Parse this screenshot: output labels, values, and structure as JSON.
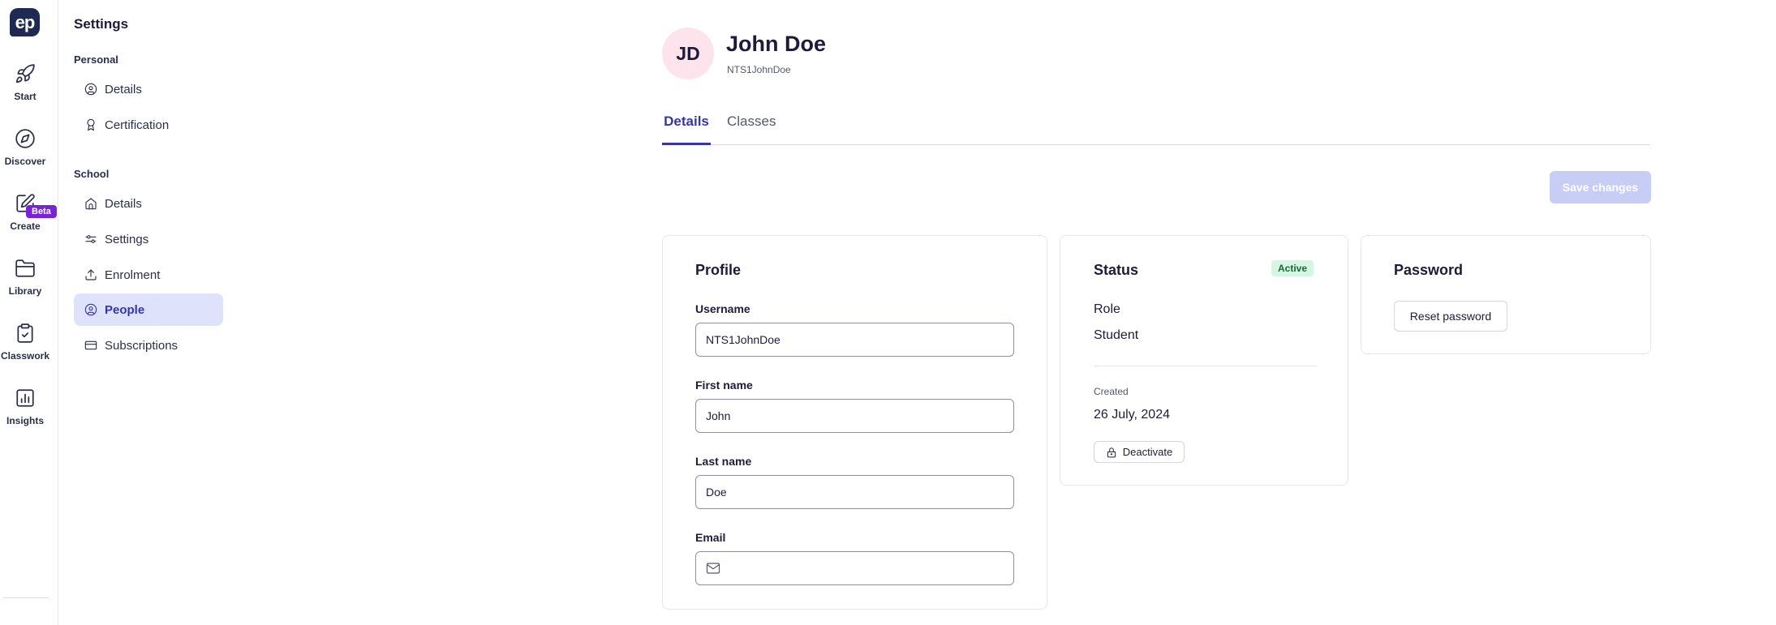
{
  "rail": {
    "logo": "ep",
    "items": [
      {
        "label": "Start",
        "icon": "rocket-icon"
      },
      {
        "label": "Discover",
        "icon": "compass-icon"
      },
      {
        "label": "Create",
        "icon": "pencil-square-icon"
      },
      {
        "label": "Library",
        "icon": "folder-icon"
      },
      {
        "label": "Classwork",
        "icon": "clipboard-check-icon"
      },
      {
        "label": "Insights",
        "icon": "bar-chart-icon"
      }
    ],
    "beta_badge": "Beta"
  },
  "sidebar": {
    "title": "Settings",
    "personal": {
      "heading": "Personal",
      "items": [
        {
          "label": "Details",
          "icon": "user-circle-icon"
        },
        {
          "label": "Certification",
          "icon": "award-icon"
        }
      ]
    },
    "school": {
      "heading": "School",
      "items": [
        {
          "label": "Details",
          "icon": "home-icon"
        },
        {
          "label": "Settings",
          "icon": "sliders-icon"
        },
        {
          "label": "Enrolment",
          "icon": "upload-icon"
        },
        {
          "label": "People",
          "icon": "user-circle-icon",
          "active": true
        },
        {
          "label": "Subscriptions",
          "icon": "credit-card-icon"
        }
      ]
    }
  },
  "user": {
    "initials": "JD",
    "name": "John Doe",
    "username": "NTS1JohnDoe"
  },
  "tabs": [
    {
      "label": "Details",
      "active": true
    },
    {
      "label": "Classes",
      "active": false
    }
  ],
  "actions": {
    "save_label": "Save changes"
  },
  "profile": {
    "title": "Profile",
    "username_label": "Username",
    "username_value": "NTS1JohnDoe",
    "first_name_label": "First name",
    "first_name_value": "John",
    "last_name_label": "Last name",
    "last_name_value": "Doe",
    "email_label": "Email",
    "email_value": ""
  },
  "status": {
    "title": "Status",
    "badge": "Active",
    "role_label": "Role",
    "role_value": "Student",
    "created_label": "Created",
    "created_value": "26 July, 2024",
    "deactivate_label": "Deactivate"
  },
  "password": {
    "title": "Password",
    "reset_label": "Reset password"
  },
  "colors": {
    "accent": "#3436a8",
    "active_bg": "#dfe2fb",
    "save_disabled": "#c8cdf6",
    "badge_bg": "#d6f5e2",
    "beta": "#7a22d6",
    "avatar_bg": "#fde4ec"
  }
}
